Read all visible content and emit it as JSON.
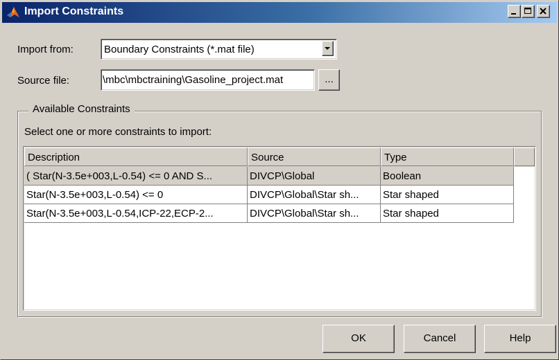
{
  "window": {
    "title": "Import Constraints",
    "icon": "matlab-logo-icon",
    "controls": [
      "minimize-icon",
      "maximize-icon",
      "close-icon"
    ]
  },
  "import_from": {
    "label": "Import from:",
    "selected": "Boundary Constraints (*.mat file)"
  },
  "source_file": {
    "label": "Source file:",
    "value": "\\mbc\\mbctraining\\Gasoline_project.mat",
    "browse_label": "..."
  },
  "group": {
    "title": "Available Constraints",
    "instruction": "Select one or more constraints to import:"
  },
  "table": {
    "columns": [
      "Description",
      "Source",
      "Type"
    ],
    "rows": [
      {
        "description": "( Star(N-3.5e+003,L-0.54) <= 0 AND S...",
        "source": "DIVCP\\Global",
        "type": "Boolean",
        "selected": true
      },
      {
        "description": "Star(N-3.5e+003,L-0.54) <= 0",
        "source": "DIVCP\\Global\\Star sh...",
        "type": "Star shaped",
        "selected": false
      },
      {
        "description": "Star(N-3.5e+003,L-0.54,ICP-22,ECP-2...",
        "source": "DIVCP\\Global\\Star sh...",
        "type": "Star shaped",
        "selected": false
      }
    ]
  },
  "buttons": {
    "ok": "OK",
    "cancel": "Cancel",
    "help": "Help"
  }
}
